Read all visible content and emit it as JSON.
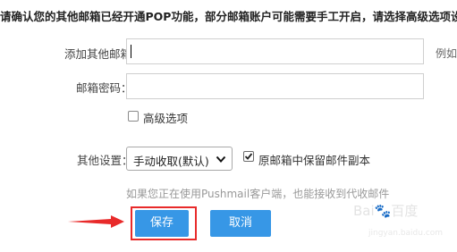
{
  "notice": "请确认您的其他邮箱已经开通POP功能，部分邮箱账户可能需要手工开启，请选择高级选项设置",
  "form": {
    "other_email_label": "添加其他邮箱：",
    "other_email_value": "",
    "example_text": "例如",
    "password_label": "邮箱密码：",
    "password_value": "",
    "advanced_label": "高级选项",
    "advanced_checked": false,
    "other_settings_label": "其他设置：",
    "receive_mode_selected": "手动收取(默认)",
    "keep_copy_label": "原邮箱中保留邮件副本",
    "keep_copy_checked": true,
    "hint": "如果您正在使用Pushmail客户端，也能接收到代收邮件"
  },
  "buttons": {
    "save": "保存",
    "cancel": "取消"
  },
  "colors": {
    "primary_button": "#3797e6",
    "highlight": "#e82a2a"
  },
  "watermark": {
    "text": "Bai🐾百度",
    "sub": "jingyan.baidu.com"
  }
}
